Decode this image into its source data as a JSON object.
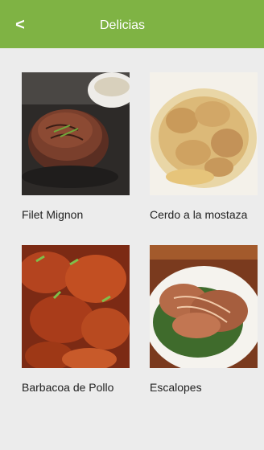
{
  "header": {
    "title": "Delicias",
    "back_label": "<"
  },
  "colors": {
    "brand": "#7fb344",
    "background": "#ececec"
  },
  "recipes": [
    {
      "name": "Filet Mignon",
      "image": "filet-mignon-photo"
    },
    {
      "name": "Cerdo a la mostaza",
      "image": "cerdo-mostaza-photo"
    },
    {
      "name": "Barbacoa de Pollo",
      "image": "barbacoa-pollo-photo"
    },
    {
      "name": "Escalopes",
      "image": "escalopes-photo"
    }
  ]
}
